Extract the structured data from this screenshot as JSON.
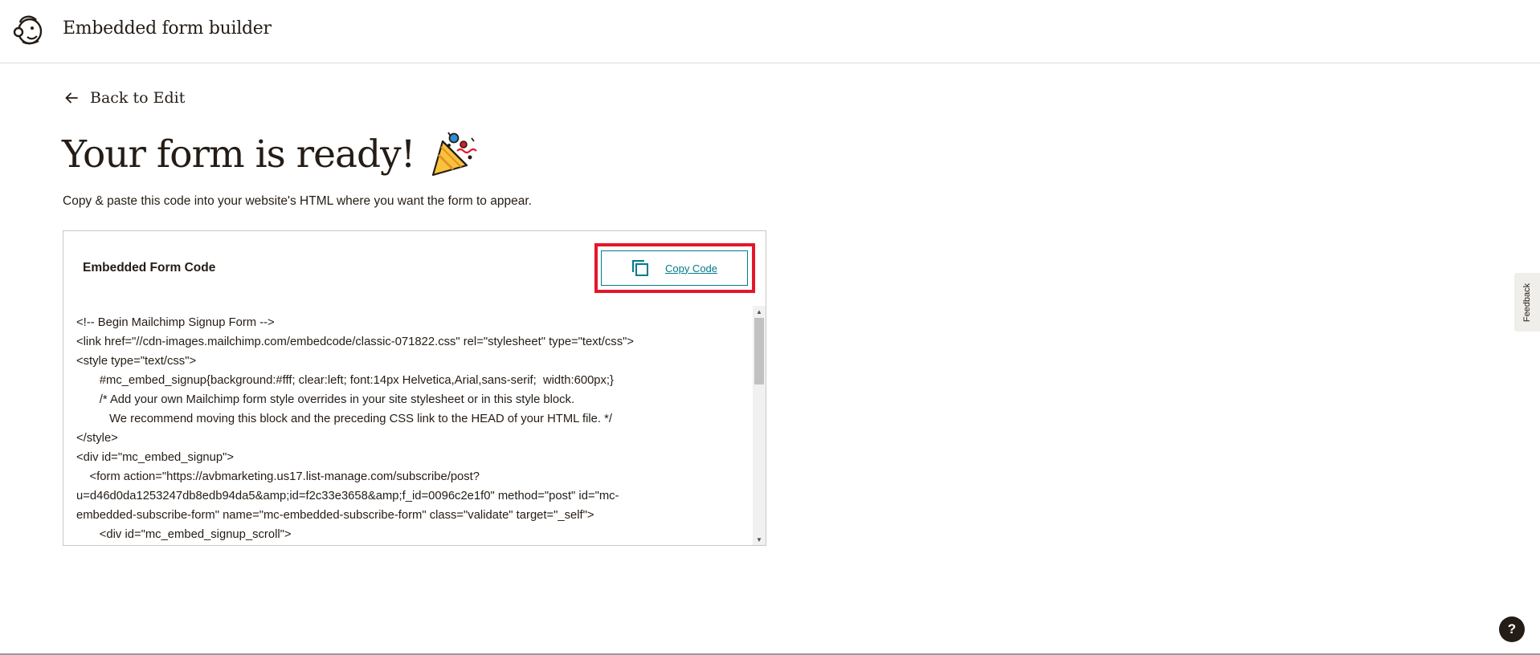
{
  "header": {
    "title": "Embedded form builder"
  },
  "back_link": {
    "label": "Back to Edit"
  },
  "page": {
    "title": "Your form is ready!",
    "subtitle": "Copy & paste this code into your website's HTML where you want the form to appear."
  },
  "code_panel": {
    "title": "Embedded Form Code",
    "copy_label": "Copy Code",
    "lines": [
      "<!-- Begin Mailchimp Signup Form -->",
      "<link href=\"//cdn-images.mailchimp.com/embedcode/classic-071822.css\" rel=\"stylesheet\" type=\"text/css\">",
      "<style type=\"text/css\">",
      "       #mc_embed_signup{background:#fff; clear:left; font:14px Helvetica,Arial,sans-serif;  width:600px;}",
      "       /* Add your own Mailchimp form style overrides in your site stylesheet or in this style block.",
      "          We recommend moving this block and the preceding CSS link to the HEAD of your HTML file. */",
      "</style>",
      "<div id=\"mc_embed_signup\">",
      "    <form action=\"https://avbmarketing.us17.list-manage.com/subscribe/post?",
      "u=d46d0da1253247db8edb94da5&amp;id=f2c33e3658&amp;f_id=0096c2e1f0\" method=\"post\" id=\"mc-",
      "embedded-subscribe-form\" name=\"mc-embedded-subscribe-form\" class=\"validate\" target=\"_self\">",
      "       <div id=\"mc_embed_signup_scroll\">"
    ]
  },
  "feedback": {
    "label": "Feedback"
  },
  "help": {
    "label": "?"
  },
  "colors": {
    "accent": "#007c89",
    "highlight": "#e5162a",
    "text": "#241c15"
  }
}
